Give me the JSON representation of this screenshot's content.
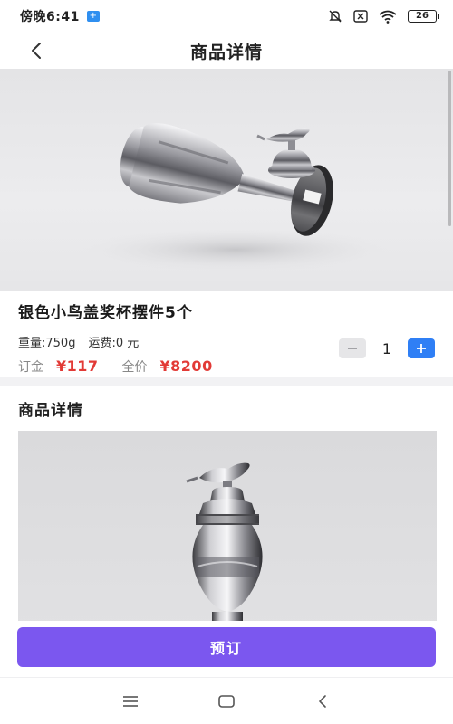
{
  "status_bar": {
    "time": "傍晚6:41",
    "battery": "26"
  },
  "header": {
    "title": "商品详情"
  },
  "product": {
    "name": "银色小鸟盖奖杯摆件5个",
    "weight": "重量:750g",
    "shipping": "运费:0 元",
    "deposit_label": "订金",
    "deposit_value": "¥117",
    "full_price_label": "全价",
    "full_price_value": "¥8200",
    "quantity": "1"
  },
  "details": {
    "title": "商品详情"
  },
  "action": {
    "reserve_label": "预订"
  },
  "colors": {
    "accent_purple": "#7b57ef",
    "price_red": "#e23a36",
    "stepper_blue": "#2f7ff5"
  },
  "icons": {
    "back": "chevron-left-icon",
    "minus": "minus-icon",
    "plus": "plus-icon",
    "menu": "menu-icon",
    "home": "home-icon",
    "nav_back": "back-icon"
  }
}
